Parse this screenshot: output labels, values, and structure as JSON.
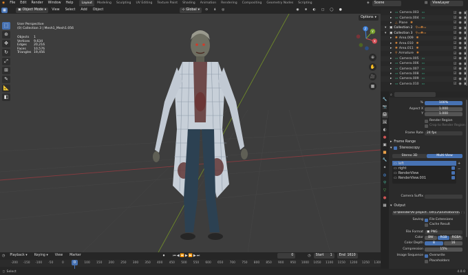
{
  "topbar": {
    "menus": [
      "File",
      "Edit",
      "Render",
      "Window",
      "Help"
    ],
    "workspaces": [
      "Layout",
      "Modeling",
      "Sculpting",
      "UV Editing",
      "Texture Paint",
      "Shading",
      "Animation",
      "Rendering",
      "Compositing",
      "Geometry Nodes",
      "Scripting"
    ],
    "active_workspace": "Layout",
    "scene": "Scene",
    "view_layer": "ViewLayer"
  },
  "viewport_header": {
    "mode": "Object Mode",
    "menus": [
      "View",
      "Select",
      "Add",
      "Object"
    ],
    "transform": "Global",
    "options": "Options"
  },
  "viewport": {
    "view_name": "User Perspective",
    "collection_path": "(0) Collection 3 | Mesh1_Mesh1.056",
    "stats": [
      {
        "label": "Objects",
        "value": "1"
      },
      {
        "label": "Vertices",
        "value": "9,634"
      },
      {
        "label": "Edges",
        "value": "20,216"
      },
      {
        "label": "Faces",
        "value": "10,576"
      },
      {
        "label": "Triangles",
        "value": "19,456"
      }
    ],
    "gizmo": {
      "x": "X",
      "y": "Y",
      "z": "Z"
    }
  },
  "timeline": {
    "menus": [
      "Playback",
      "Keying",
      "View",
      "Marker"
    ],
    "current_frame": "0",
    "start_label": "Start",
    "start": "1",
    "end_label": "End",
    "end": "1610",
    "ruler": [
      "-200",
      "-150",
      "-100",
      "-50",
      "0",
      "50",
      "100",
      "150",
      "200",
      "250",
      "300",
      "350",
      "400",
      "450",
      "500",
      "550",
      "600",
      "650",
      "700",
      "750",
      "800",
      "850",
      "900",
      "950",
      "1000",
      "1050",
      "1100",
      "1150",
      "1200",
      "1250",
      "1300"
    ]
  },
  "statusbar": {
    "left": "Select",
    "right": "4.0.0"
  },
  "outliner": {
    "rows": [
      {
        "name": "Camera.003",
        "type": "camera"
      },
      {
        "name": "Camera.004",
        "type": "camera"
      },
      {
        "name": "Plane",
        "type": "mesh"
      },
      {
        "name": "Collection 2",
        "type": "collection"
      },
      {
        "name": "Collection 3",
        "type": "collection"
      },
      {
        "name": "Area.009",
        "type": "light"
      },
      {
        "name": "Area.010",
        "type": "light"
      },
      {
        "name": "Area.011",
        "type": "light"
      },
      {
        "name": "Armature",
        "type": "armature"
      },
      {
        "name": "Camera.005",
        "type": "camera"
      },
      {
        "name": "Camera.006",
        "type": "camera"
      },
      {
        "name": "Camera.007",
        "type": "camera"
      },
      {
        "name": "Camera.008",
        "type": "camera"
      },
      {
        "name": "Camera.009",
        "type": "camera"
      },
      {
        "name": "Camera.010",
        "type": "camera"
      }
    ]
  },
  "properties": {
    "percent_label": "%",
    "percent": "100%",
    "aspect_x_label": "Aspect X",
    "aspect_x": "1.000",
    "aspect_y_label": "Y",
    "aspect_y": "1.000",
    "render_region": "Render Region",
    "crop_region": "Crop to Render Region",
    "frame_rate_label": "Frame Rate",
    "frame_rate": "24 fps",
    "frame_range": "Frame Range",
    "stereoscopy": "Stereoscopy",
    "stereo_3d": "Stereo 3D",
    "multi_view": "Multi-View",
    "views": [
      "left",
      "right",
      "RenderView",
      "RenderView.001"
    ],
    "camera_suffix_label": "Camera Suffix",
    "output": "Output",
    "output_path": "D:\\blender\\AI project...04\\12\\animation\\01",
    "saving_label": "Saving",
    "file_extensions": "File Extensions",
    "cache_result": "Cache Result",
    "file_format_label": "File Format",
    "file_format": "PNG",
    "color_label": "Color",
    "color_options": [
      "BW",
      "RGB",
      "RGBA"
    ],
    "color_depth_label": "Color Depth",
    "color_depth_options": [
      "8",
      "16"
    ],
    "compression_label": "Compression",
    "compression": "15%",
    "image_sequence_label": "Image Sequence",
    "overwrite": "Overwrite",
    "placeholders": "Placeholders"
  },
  "colors": {
    "accent": "#4772b3",
    "camera": "#3ab58a",
    "light": "#e08b3a",
    "collection": "#e0e0e0"
  }
}
